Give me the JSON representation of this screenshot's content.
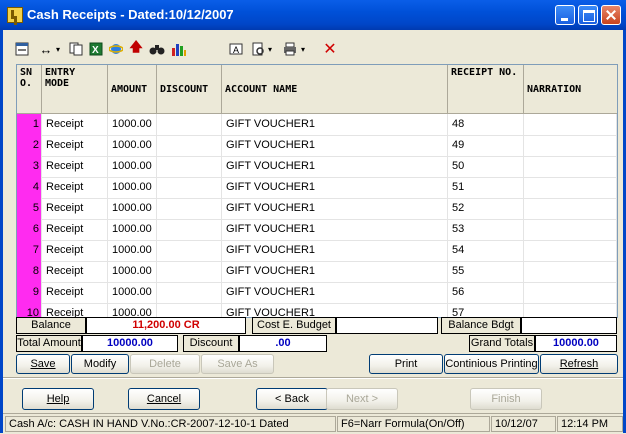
{
  "window": {
    "title": "Cash Receipts - Dated:10/12/2007"
  },
  "toolbar": {
    "icons": [
      "form-icon",
      "resize-arrows-icon",
      "copy-icon",
      "excel-icon",
      "internet-explorer-icon",
      "up-arrow-icon",
      "binoculars-icon",
      "bar-chart-icon",
      "text-box-icon",
      "print-preview-icon",
      "printer-icon",
      "delete-x-icon"
    ]
  },
  "grid": {
    "headers": {
      "sno": "SN O.",
      "entry_mode": "ENTRY MODE",
      "amount": "AMOUNT",
      "discount": "DISCOUNT",
      "account_name": "ACCOUNT NAME",
      "receipt_no": "RECEIPT NO.",
      "narration": "NARRATION"
    },
    "rows": [
      {
        "sno": "1",
        "mode": "Receipt",
        "amount": "1000.00",
        "discount": "",
        "account": "GIFT VOUCHER1",
        "receipt": "48",
        "narration": ""
      },
      {
        "sno": "2",
        "mode": "Receipt",
        "amount": "1000.00",
        "discount": "",
        "account": "GIFT VOUCHER1",
        "receipt": "49",
        "narration": ""
      },
      {
        "sno": "3",
        "mode": "Receipt",
        "amount": "1000.00",
        "discount": "",
        "account": "GIFT VOUCHER1",
        "receipt": "50",
        "narration": ""
      },
      {
        "sno": "4",
        "mode": "Receipt",
        "amount": "1000.00",
        "discount": "",
        "account": "GIFT VOUCHER1",
        "receipt": "51",
        "narration": ""
      },
      {
        "sno": "5",
        "mode": "Receipt",
        "amount": "1000.00",
        "discount": "",
        "account": "GIFT VOUCHER1",
        "receipt": "52",
        "narration": ""
      },
      {
        "sno": "6",
        "mode": "Receipt",
        "amount": "1000.00",
        "discount": "",
        "account": "GIFT VOUCHER1",
        "receipt": "53",
        "narration": ""
      },
      {
        "sno": "7",
        "mode": "Receipt",
        "amount": "1000.00",
        "discount": "",
        "account": "GIFT VOUCHER1",
        "receipt": "54",
        "narration": ""
      },
      {
        "sno": "8",
        "mode": "Receipt",
        "amount": "1000.00",
        "discount": "",
        "account": "GIFT VOUCHER1",
        "receipt": "55",
        "narration": ""
      },
      {
        "sno": "9",
        "mode": "Receipt",
        "amount": "1000.00",
        "discount": "",
        "account": "GIFT VOUCHER1",
        "receipt": "56",
        "narration": ""
      },
      {
        "sno": "10",
        "mode": "Receipt",
        "amount": "1000.00",
        "discount": "",
        "account": "GIFT VOUCHER1",
        "receipt": "57",
        "narration": ""
      }
    ]
  },
  "summary": {
    "balance_label": "Balance",
    "balance_value": "11,200.00 CR",
    "cost_budget_label": "Cost E. Budget",
    "cost_budget_value": "",
    "balance_bdgt_label": "Balance Bdgt",
    "balance_bdgt_value": "",
    "total_amount_label": "Total Amount",
    "total_amount_value": "10000.00",
    "discount_label": "Discount",
    "discount_value": ".00",
    "grand_totals_label": "Grand Totals",
    "grand_totals_value": "10000.00"
  },
  "actions": {
    "save": "Save",
    "modify": "Modify",
    "delete": "Delete",
    "save_as": "Save As",
    "print": "Print",
    "continuous_printing": "Continious Printing",
    "refresh": "Refresh"
  },
  "wizard": {
    "help": "Help",
    "cancel": "Cancel",
    "back": "< Back",
    "next": "Next >",
    "finish": "Finish"
  },
  "status": {
    "account": "Cash A/c: CASH IN HAND V.No.:CR-2007-12-10-1 Dated",
    "hint": "F6=Narr Formula(On/Off)",
    "date": "10/12/07",
    "time": "12:14 PM"
  },
  "colors": {
    "title_bar": "#0050d8",
    "sno_cell": "#ff2bf0",
    "balance_value": "#d00000",
    "totals_value": "#0000c0"
  }
}
